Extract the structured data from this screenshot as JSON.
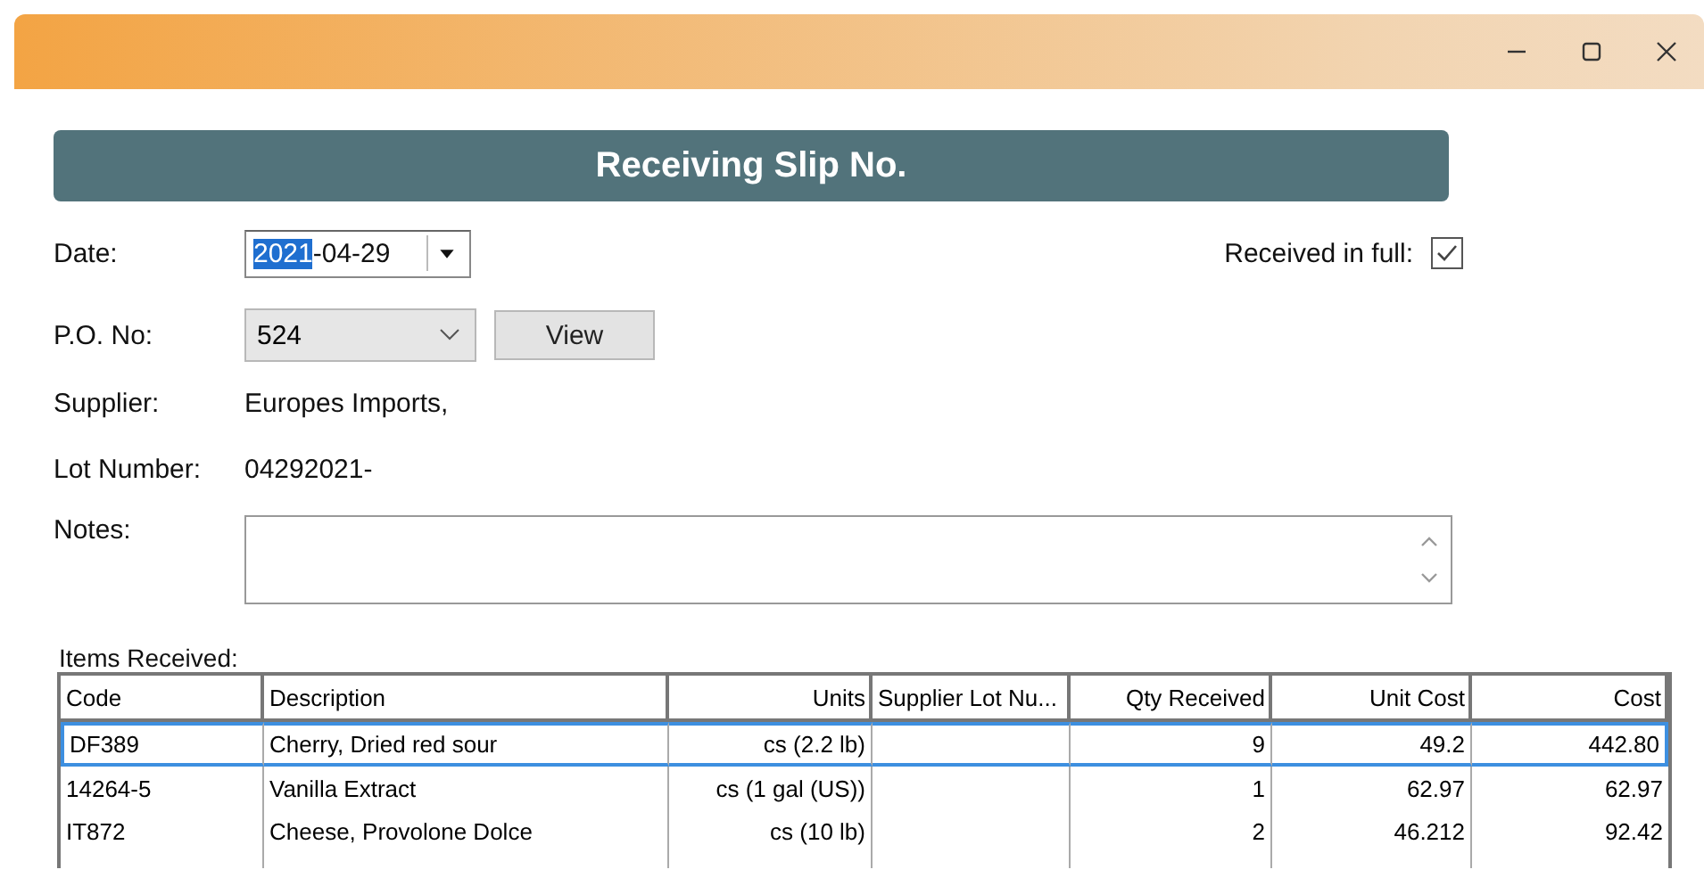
{
  "banner": {
    "title": "Receiving Slip No."
  },
  "date": {
    "label": "Date:",
    "parts": [
      {
        "text": "2021",
        "selected": true
      },
      {
        "text": "-04-29",
        "selected": false
      }
    ]
  },
  "received_in_full": {
    "label": "Received in full:",
    "checked": true
  },
  "po": {
    "label": "P.O. No:",
    "value": "524",
    "button": "View"
  },
  "supplier": {
    "label": "Supplier:",
    "value": "Europes Imports,"
  },
  "lot_number": {
    "label": "Lot Number:",
    "value": "04292021-"
  },
  "notes": {
    "label": "Notes:"
  },
  "items": {
    "label": "Items Received:",
    "columns": [
      {
        "label": "Code",
        "kind": "text"
      },
      {
        "label": "Description",
        "kind": "text"
      },
      {
        "label": "Units",
        "kind": "number"
      },
      {
        "label": "Supplier Lot Nu...",
        "kind": "text"
      },
      {
        "label": "Qty Received",
        "kind": "number"
      },
      {
        "label": "Unit Cost",
        "kind": "number"
      },
      {
        "label": "Cost",
        "kind": "number"
      }
    ],
    "rows": [
      {
        "selected": true,
        "cells": [
          "DF389",
          "Cherry, Dried red sour",
          "cs (2.2 lb)",
          "",
          "9",
          "49.2",
          "442.80"
        ]
      },
      {
        "selected": false,
        "cells": [
          "14264-5",
          "Vanilla Extract",
          "cs (1 gal (US))",
          "",
          "1",
          "62.97",
          "62.97"
        ]
      },
      {
        "selected": false,
        "cells": [
          "IT872",
          "Cheese, Provolone Dolce",
          "cs (10 lb)",
          "",
          "2",
          "46.212",
          "92.42"
        ]
      }
    ]
  }
}
